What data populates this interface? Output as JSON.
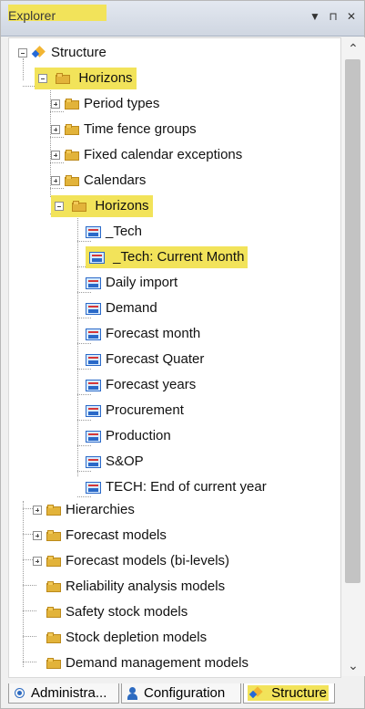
{
  "header": {
    "title": "Explorer",
    "buttons": [
      "▼",
      "⊓",
      "✕"
    ]
  },
  "tree": {
    "root": "Structure",
    "top_horizons": "Horizons",
    "children": [
      "Period types",
      "Time fence groups",
      "Fixed calendar exceptions",
      "Calendars",
      "Horizons"
    ],
    "horizon_items": [
      "_Tech",
      "_Tech: Current Month",
      "Daily import",
      "Demand",
      "Forecast month",
      "Forecast Quater",
      "Forecast years",
      "Procurement",
      "Production",
      "S&OP",
      "TECH: End of current year"
    ],
    "after": [
      "Hierarchies",
      "Forecast models",
      "Forecast models (bi-levels)",
      "Reliability analysis models",
      "Safety stock models",
      "Stock depletion models",
      "Demand management models"
    ]
  },
  "tabs": [
    {
      "label": "Administra...",
      "icon": "admin-icon"
    },
    {
      "label": "Configuration",
      "icon": "user-icon"
    },
    {
      "label": "Structure",
      "icon": "structure-icon"
    }
  ],
  "scroll": {
    "up": "⌃",
    "down": "⌄"
  }
}
